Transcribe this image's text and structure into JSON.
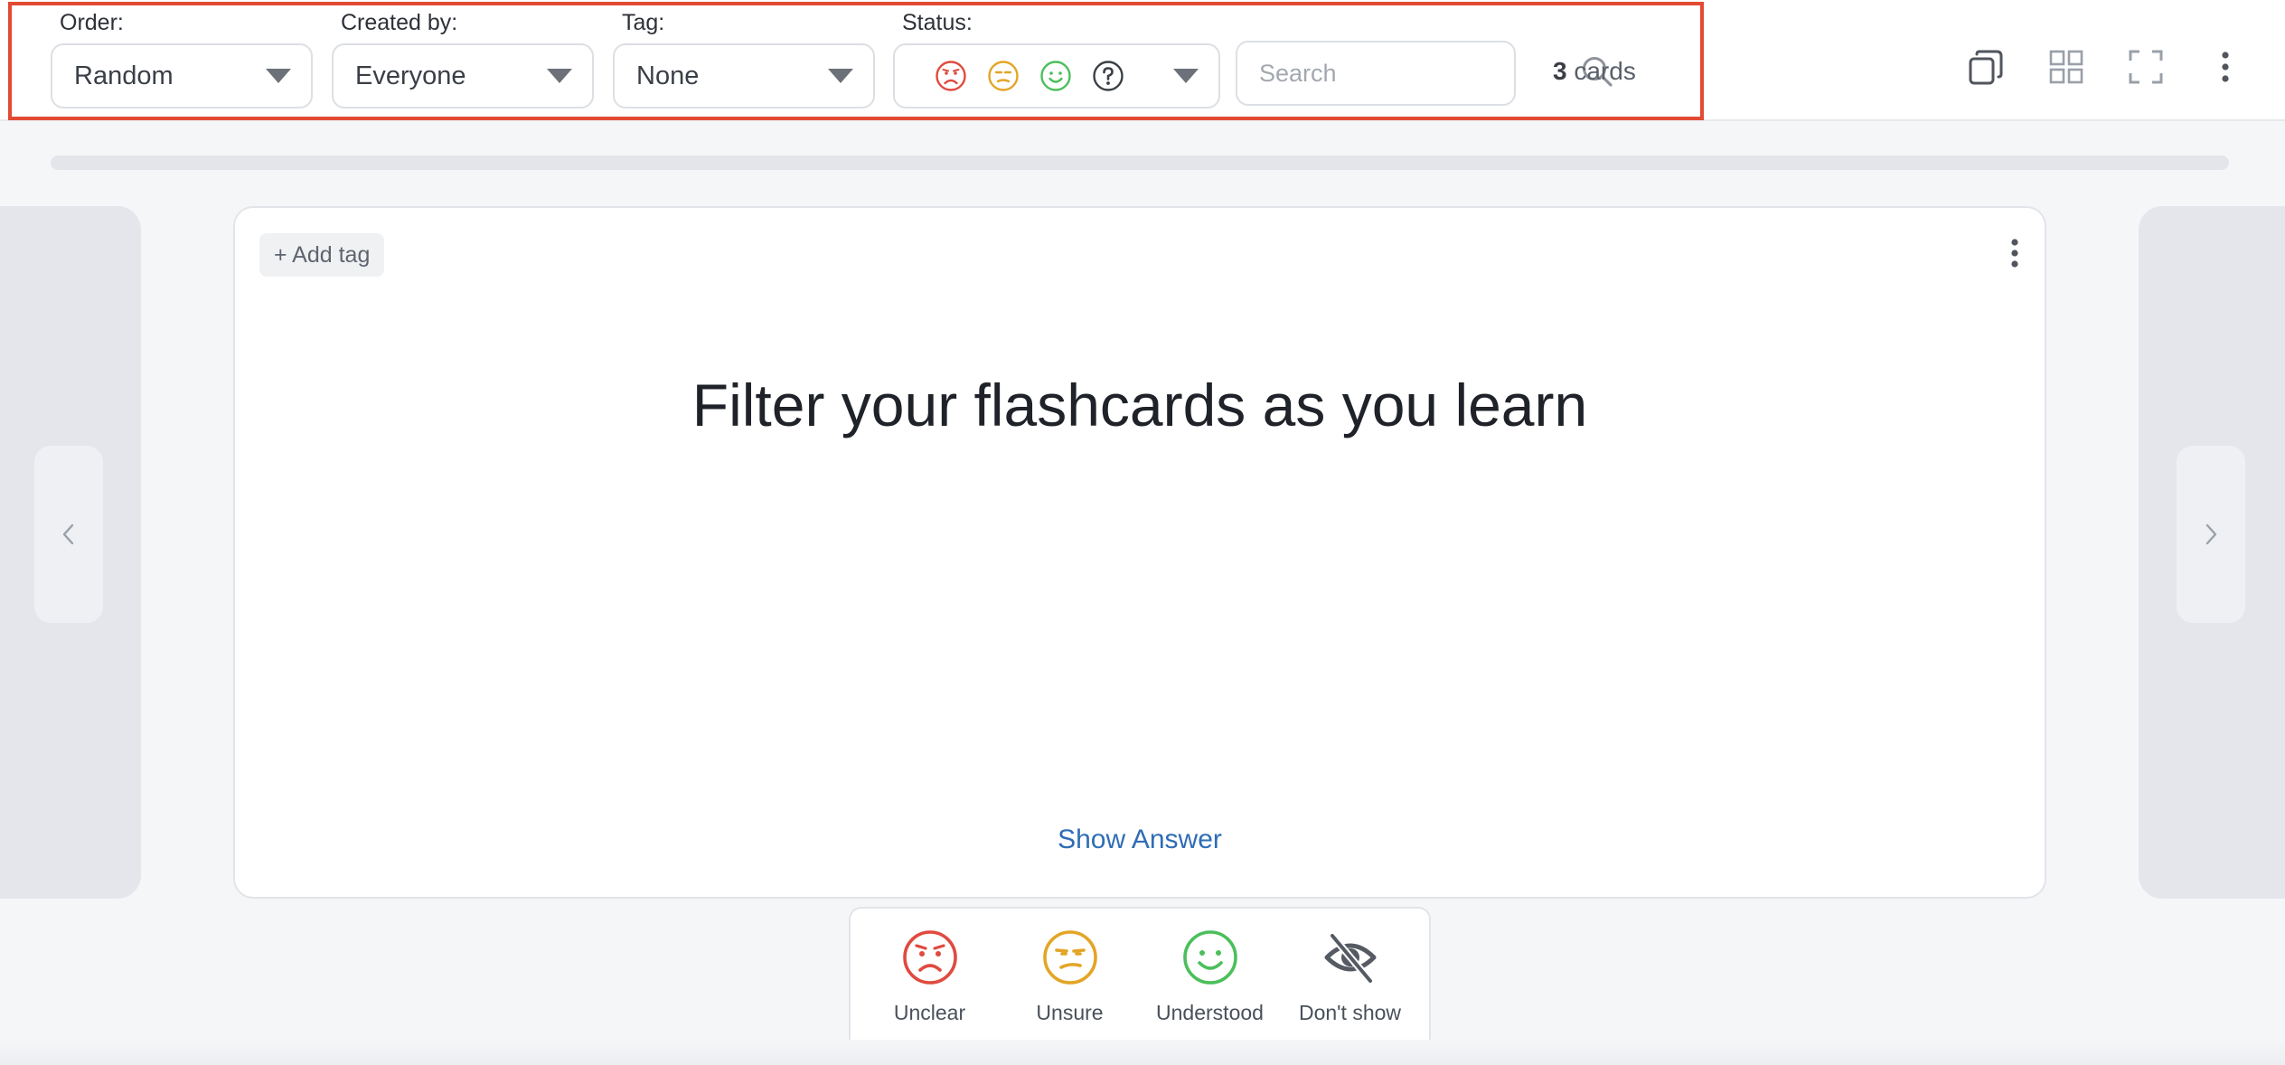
{
  "toolbar": {
    "order": {
      "label": "Order:",
      "value": "Random"
    },
    "created_by": {
      "label": "Created by:",
      "value": "Everyone"
    },
    "tag": {
      "label": "Tag:",
      "value": "None"
    },
    "status": {
      "label": "Status:",
      "icons": [
        "sad-face-icon",
        "unsure-face-icon",
        "happy-face-icon",
        "question-circle-icon"
      ]
    },
    "search": {
      "placeholder": "Search"
    },
    "card_count": {
      "number": "3",
      "unit": " cards"
    },
    "tools": [
      "copy-icon",
      "grid-view-icon",
      "fullscreen-icon",
      "more-vertical-icon"
    ]
  },
  "progress": {
    "fraction": 0
  },
  "card": {
    "add_tag_label": "+ Add tag",
    "question": "Filter your flashcards as you learn",
    "show_answer_label": "Show Answer"
  },
  "rating": {
    "items": [
      {
        "label": "Unclear",
        "icon": "sad-face-icon",
        "color": "#e04a3f"
      },
      {
        "label": "Unsure",
        "icon": "unsure-face-icon",
        "color": "#e3a526"
      },
      {
        "label": "Understood",
        "icon": "happy-face-icon",
        "color": "#4bbf5b"
      },
      {
        "label": "Don't show",
        "icon": "eye-off-icon",
        "color": "#555a63"
      }
    ]
  },
  "colors": {
    "highlight_frame": "#e24a33",
    "link": "#2f6db5",
    "unclear": "#e04a3f",
    "unsure": "#e3a526",
    "understood": "#4bbf5b"
  }
}
